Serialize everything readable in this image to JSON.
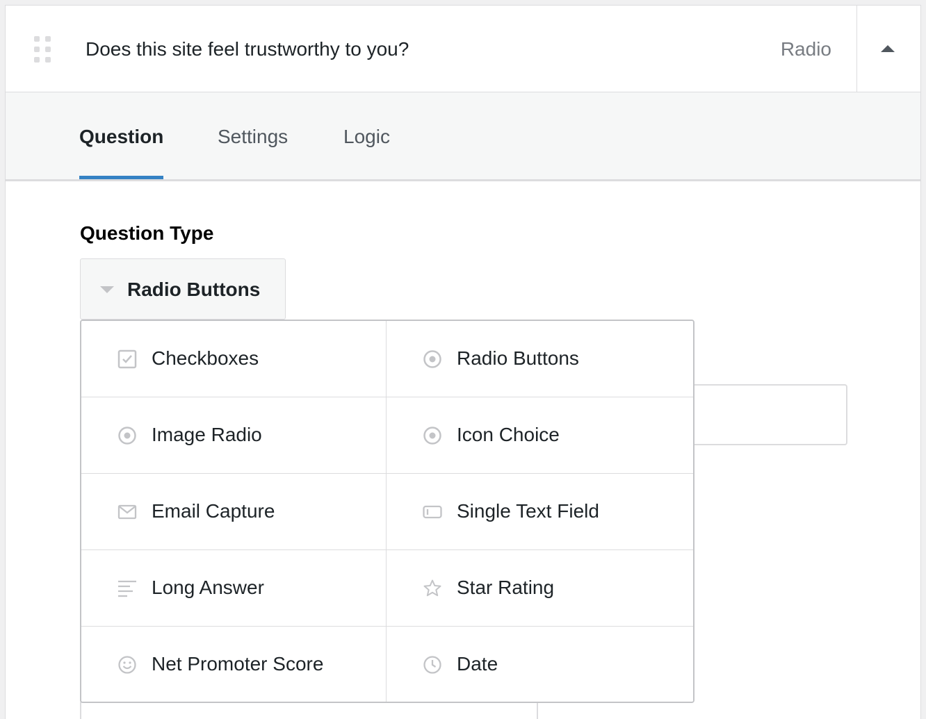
{
  "header": {
    "question_title": "Does this site feel trustworthy to you?",
    "question_type": "Radio",
    "drag_icon": "drag-handle-icon",
    "toggle_icon": "caret-up-icon"
  },
  "tabs": [
    {
      "label": "Question",
      "active": true
    },
    {
      "label": "Settings",
      "active": false
    },
    {
      "label": "Logic",
      "active": false
    }
  ],
  "question_type_section": {
    "label": "Question Type",
    "selected": "Radio Buttons",
    "dropdown_icon": "caret-down-icon"
  },
  "type_options": [
    {
      "label": "Checkboxes",
      "icon": "checkbox-icon"
    },
    {
      "label": "Radio Buttons",
      "icon": "radio-icon"
    },
    {
      "label": "Image Radio",
      "icon": "radio-icon"
    },
    {
      "label": "Icon Choice",
      "icon": "radio-icon"
    },
    {
      "label": "Email Capture",
      "icon": "envelope-icon"
    },
    {
      "label": "Single Text Field",
      "icon": "text-field-icon"
    },
    {
      "label": "Long Answer",
      "icon": "paragraph-icon"
    },
    {
      "label": "Star Rating",
      "icon": "star-icon"
    },
    {
      "label": "Net Promoter Score",
      "icon": "smiley-icon"
    },
    {
      "label": "Date",
      "icon": "clock-icon"
    }
  ],
  "colors": {
    "accent": "#3582c4",
    "border": "#dcdcde",
    "icon_gray": "#c3c4c7",
    "text": "#1d2327",
    "muted": "#787c82"
  }
}
